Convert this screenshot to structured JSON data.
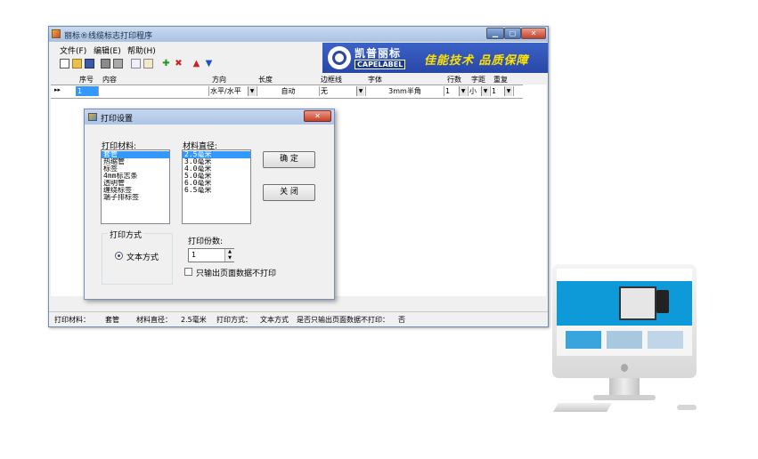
{
  "window": {
    "title": "丽标®线缆标志打印程序",
    "caption_buttons": {
      "minimize": "▁",
      "maximize": "▢",
      "close": "✕"
    }
  },
  "menu": {
    "items": [
      "文件(F)",
      "编辑(E)",
      "帮助(H)"
    ]
  },
  "toolbar": {
    "icons": [
      "new-icon",
      "open-icon",
      "save-icon",
      "print-icon",
      "print-preview-icon",
      "copy-icon",
      "paste-icon",
      "add-icon",
      "delete-icon",
      "move-up-icon",
      "move-down-icon"
    ]
  },
  "banner": {
    "brand_cn": "凯普丽标",
    "brand_en": "CAPELABEL",
    "slogan": "佳能技术 品质保障"
  },
  "grid": {
    "columns": [
      "序号",
      "内容",
      "方向",
      "长度",
      "边框线",
      "字体",
      "行数",
      "字距",
      "重复"
    ],
    "row": {
      "index": "1",
      "content": "",
      "direction": "水平/水平",
      "length": "自动",
      "border": "无",
      "font": "3mm半角",
      "lines": "1",
      "spacing": "小",
      "repeat": "1"
    },
    "row_marker": "▸▸"
  },
  "dialog": {
    "title": "打印设置",
    "close": "✕",
    "material_label": "打印材料:",
    "materials": [
      "套管",
      "热缩管",
      "标签",
      "4mm标志条",
      "透明管",
      "缠绕标签",
      "端子排标签"
    ],
    "material_selected": 0,
    "diameter_label": "材料直径:",
    "diameters": [
      "2.5毫米",
      "3.0毫米",
      "4.0毫米",
      "5.0毫米",
      "6.0毫米",
      "6.5毫米"
    ],
    "diameter_selected": 0,
    "ok_label": "确 定",
    "close_label": "关 闭",
    "mode_group_label": "打印方式",
    "mode_option": "文本方式",
    "copies_label": "打印份数:",
    "copies_value": "1",
    "only_data_label": "只输出页面数据不打印"
  },
  "status": {
    "material_key": "打印材料：",
    "material_val": "套管",
    "diameter_key": "材料直径：",
    "diameter_val": "2.5毫米",
    "mode_key": "打印方式：",
    "mode_val": "文本方式",
    "only_key": "是否只输出页面数据不打印：",
    "only_val": "否"
  },
  "colors": {
    "banner_blue": "#2847a8",
    "slogan_yellow": "#ffe200",
    "selection": "#3399ff"
  }
}
